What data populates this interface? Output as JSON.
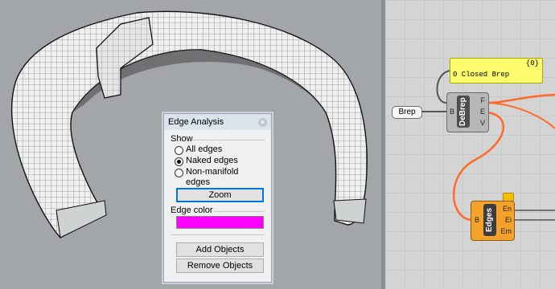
{
  "dialog": {
    "title": "Edge Analysis",
    "show_label": "Show",
    "options": [
      {
        "label": "All edges",
        "checked": false
      },
      {
        "label": "Naked edges",
        "checked": true
      },
      {
        "label": "Non-manifold",
        "label2": "edges",
        "checked": false
      }
    ],
    "zoom_label": "Zoom",
    "edge_color_label": "Edge color",
    "edge_color": "#ff00ff",
    "add_objects_label": "Add Objects",
    "remove_objects_label": "Remove Objects"
  },
  "grasshopper": {
    "panel": {
      "tag": "{0}",
      "text": "0 Closed Brep"
    },
    "brep_param": "Brep",
    "debrep": {
      "name": "DeBrep",
      "input": "B",
      "outputs": [
        "F",
        "E",
        "V"
      ]
    },
    "edges": {
      "name": "Edges",
      "input": "B",
      "outputs": [
        "En",
        "Ei",
        "Em"
      ]
    }
  },
  "colors": {
    "viewport_bg": "#a3a6a8",
    "wire": "#ff6a2a",
    "panel_bg": "#fcfc6c",
    "edges_component": "#f5a22a"
  }
}
